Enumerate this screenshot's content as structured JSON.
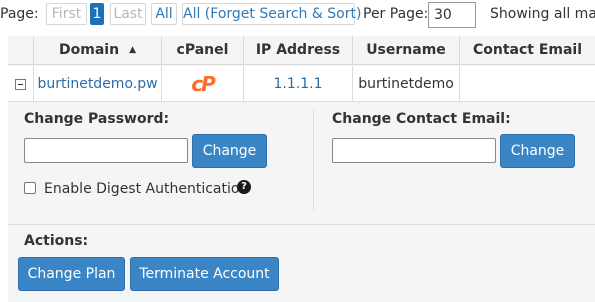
{
  "pager": {
    "page_label": "Page:",
    "first": "First",
    "current_page": "1",
    "last": "Last",
    "all": "All",
    "all_forget": "All (Forget Search & Sort)",
    "per_page_label": "Per Page:",
    "per_page_value": "30",
    "showing_text": "Showing all mat"
  },
  "table": {
    "columns": [
      "Domain",
      "cPanel",
      "IP Address",
      "Username",
      "Contact Email"
    ],
    "row": {
      "domain": "burtinetdemo.pw",
      "cpanel_logo": "cP",
      "ip": "1.1.1.1",
      "username": "burtinetdemo",
      "contact_email": ""
    }
  },
  "details": {
    "change_password_label": "Change Password:",
    "change_button": "Change",
    "digest_label": "Enable Digest Authentication",
    "change_email_label": "Change Contact Email:",
    "change_email_button": "Change",
    "actions_label": "Actions:",
    "change_plan_button": "Change Plan",
    "terminate_button": "Terminate Account"
  },
  "icons": {
    "sort": "sort-asc-icon",
    "expand": "collapse-icon",
    "cpanel": "cpanel-icon",
    "help": "help-icon"
  },
  "colors": {
    "link": "#2d6ca8",
    "button": "#3a85c6",
    "current_page": "#1d70b8",
    "cpanel_orange": "#ff6c2c",
    "panel_bg": "#f5f5f5"
  }
}
